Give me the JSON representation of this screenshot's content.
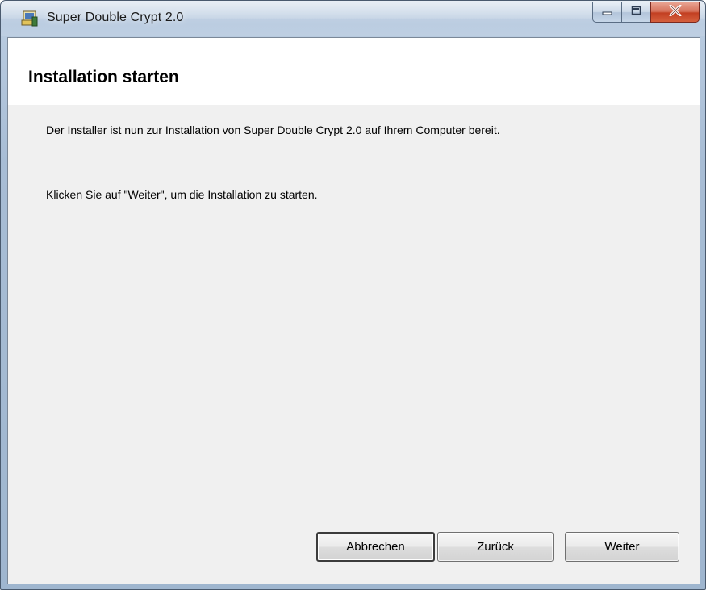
{
  "window": {
    "title": "Super Double Crypt 2.0",
    "icon": "installer-app-icon",
    "controls": {
      "minimize_icon": "minimize-icon",
      "maximize_icon": "maximize-icon",
      "close_icon": "close-icon"
    }
  },
  "header": {
    "title": "Installation starten"
  },
  "content": {
    "line1": "Der Installer ist nun zur Installation von Super Double Crypt 2.0 auf Ihrem Computer bereit.",
    "line2": "Klicken Sie auf \"Weiter\", um die Installation zu starten."
  },
  "buttons": {
    "cancel_label": "Abbrechen",
    "back_label": "Zurück",
    "next_label": "Weiter"
  },
  "colors": {
    "close_button": "#c23f22",
    "client_background": "#f0f0f0",
    "header_background": "#ffffff"
  }
}
